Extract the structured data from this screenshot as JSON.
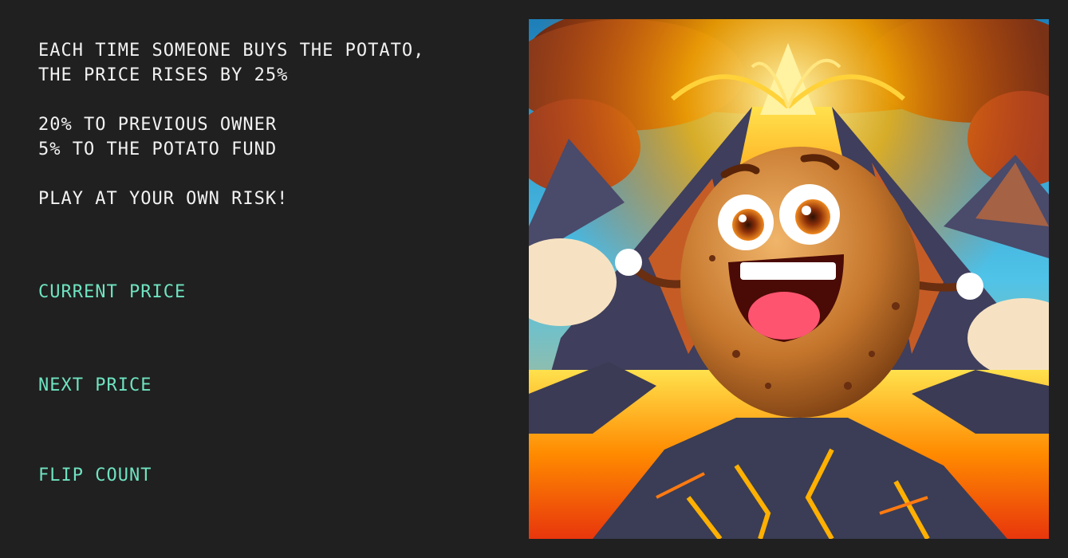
{
  "rules": {
    "line1": "EACH TIME SOMEONE BUYS THE POTATO,",
    "line2": "THE PRICE RISES BY 25%",
    "line3": "20% TO PREVIOUS OWNER",
    "line4": "5% TO THE POTATO FUND",
    "line5": "PLAY AT YOUR OWN RISK!"
  },
  "stats": {
    "current_price_label": "CURRENT PRICE",
    "next_price_label": "NEXT PRICE",
    "flip_count_label": "FLIP COUNT"
  },
  "colors": {
    "background": "#202020",
    "text": "#f2f2f2",
    "accent": "#6fe3c0"
  }
}
